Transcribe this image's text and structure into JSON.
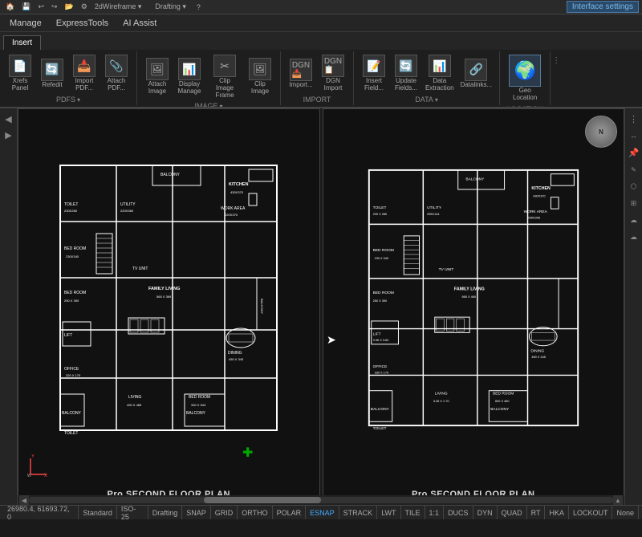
{
  "topbar": {
    "icons": [
      "⬛",
      "⬛",
      "⬛",
      "⬛",
      "⬛",
      "⬛",
      "⬛",
      "⬛",
      "⬛"
    ],
    "view_mode": "2dWireframe",
    "workspace": "Drafting",
    "interface_settings": "Interface settings"
  },
  "menubar": {
    "items": [
      "Manage",
      "ExpressTools",
      "AI Assist"
    ]
  },
  "ribbon": {
    "active_tab": "Insert",
    "tabs": [
      "Insert"
    ],
    "groups": [
      {
        "id": "pdfs",
        "label": "PDFS",
        "buttons": [
          {
            "icon": "📄",
            "label": "Xrefs\nPanel"
          },
          {
            "icon": "🔄",
            "label": "Refedit"
          },
          {
            "icon": "📥",
            "label": "Import\nPDF..."
          },
          {
            "icon": "📎",
            "label": "Attach\nPDF..."
          }
        ]
      },
      {
        "id": "image",
        "label": "IMAGE",
        "buttons": [
          {
            "icon": "🖼",
            "label": "Attach\nImage"
          },
          {
            "icon": "📊",
            "label": "Display\nManagement"
          },
          {
            "icon": "✂",
            "label": "Clip\nImage Frame"
          },
          {
            "icon": "🖼",
            "label": "Clip\nImage"
          }
        ]
      },
      {
        "id": "import",
        "label": "IMPORT",
        "buttons": [
          {
            "icon": "📥",
            "label": "Import..."
          },
          {
            "icon": "📋",
            "label": "DGN\nImport"
          }
        ]
      },
      {
        "id": "data",
        "label": "DATA",
        "buttons": [
          {
            "icon": "📝",
            "label": "Insert\nField..."
          },
          {
            "icon": "🔄",
            "label": "Update\nFields..."
          },
          {
            "icon": "📊",
            "label": "Data\nExtraction"
          },
          {
            "icon": "🔗",
            "label": "Datalinks..."
          }
        ]
      },
      {
        "id": "location",
        "label": "LOCATION",
        "buttons": [
          {
            "icon": "🌍",
            "label": "Geo\nLocation"
          }
        ]
      }
    ]
  },
  "viewport": {
    "left_panel": {
      "title": "Pro.SECOND  FLOOR PLAN"
    },
    "right_panel": {
      "title": "Pro.SECOND  FLOOR PLAN"
    }
  },
  "right_sidebar": {
    "buttons": [
      "≡",
      "✎",
      "📌",
      "🔍",
      "⬡",
      "☁"
    ]
  },
  "statusbar": {
    "coordinates": "26980.4, 61693.72, 0",
    "items": [
      {
        "label": "Standard",
        "active": false
      },
      {
        "label": "ISO-25",
        "active": false
      },
      {
        "label": "Drafting",
        "active": false
      },
      {
        "label": "SNAP",
        "active": false
      },
      {
        "label": "GRID",
        "active": false
      },
      {
        "label": "ORTHO",
        "active": false
      },
      {
        "label": "POLAR",
        "active": false
      },
      {
        "label": "ESNAP",
        "active": true
      },
      {
        "label": "STRACK",
        "active": false
      },
      {
        "label": "LWT",
        "active": false
      },
      {
        "label": "TILE",
        "active": false
      },
      {
        "label": "1:1",
        "active": false
      },
      {
        "label": "DUCS",
        "active": false
      },
      {
        "label": "DYN",
        "active": false
      },
      {
        "label": "QUAD",
        "active": false
      },
      {
        "label": "RT",
        "active": false
      },
      {
        "label": "HKA",
        "active": false
      },
      {
        "label": "LOCKOUT",
        "active": false
      },
      {
        "label": "None",
        "active": false
      }
    ]
  }
}
